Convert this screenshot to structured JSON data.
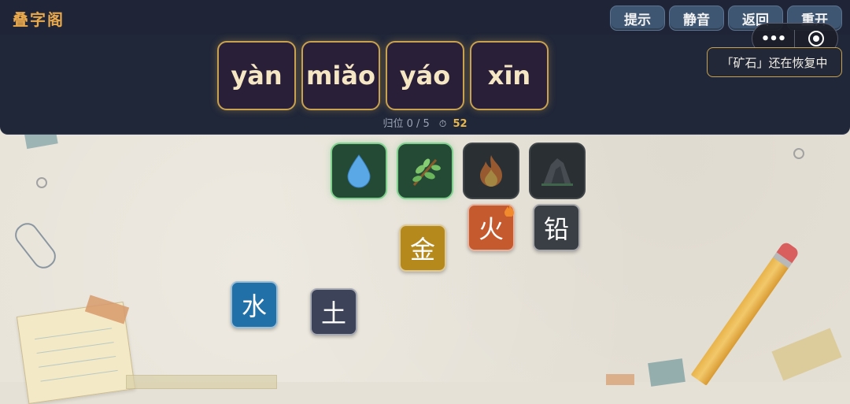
{
  "app": {
    "title": "叠字阁"
  },
  "toolbar": {
    "buttons": [
      {
        "label": "提示"
      },
      {
        "label": "静音"
      },
      {
        "label": "返回"
      },
      {
        "label": "重开"
      }
    ]
  },
  "capsule": {
    "more_label": "•••"
  },
  "toast": {
    "text": "「矿石」还在恢复中"
  },
  "puzzle": {
    "pinyin": [
      "yàn",
      "miǎo",
      "yáo",
      "xīn"
    ],
    "progress_text": "归位 0 / 5",
    "timer": "52"
  },
  "slots": [
    {
      "icon": "water-drop-icon",
      "state": "active"
    },
    {
      "icon": "sprout-branch-icon",
      "state": "active"
    },
    {
      "icon": "fire-icon",
      "state": "locked"
    },
    {
      "icon": "ore-rock-icon",
      "state": "locked"
    }
  ],
  "tiles": {
    "jin": {
      "char": "金",
      "color": "#b5891c"
    },
    "huo": {
      "char": "火",
      "color": "#c55a2e"
    },
    "qian": {
      "char": "铅",
      "color": "#3a3f45"
    },
    "shui": {
      "char": "水",
      "color": "#2270a8"
    },
    "tu": {
      "char": "土",
      "color": "#3d4358"
    }
  }
}
